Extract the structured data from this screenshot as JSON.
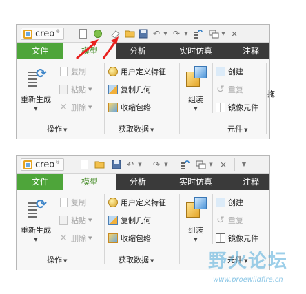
{
  "ribbon_top": {
    "logo_text": "creo",
    "logo_mark": "®",
    "qat_icons": [
      "new-icon",
      "open-icon",
      "save-icon",
      "undo-icon",
      "redo-icon",
      "regenerate-icon",
      "windows-icon",
      "close-window-icon"
    ],
    "tabs": [
      {
        "label": "文件"
      },
      {
        "label": "模型"
      },
      {
        "label": "分析"
      },
      {
        "label": "实时仿真"
      },
      {
        "label": "注释"
      }
    ],
    "groups": {
      "operations": {
        "title": "操作",
        "regenerate": "重新生成",
        "copy": "复制",
        "paste": "粘贴",
        "delete": "删除"
      },
      "get_data": {
        "title": "获取数据",
        "udf": "用户定义特征",
        "copy_geometry": "复制几何",
        "shrinkwrap": "收缩包络"
      },
      "body": {
        "title": "元件",
        "assemble": "组装",
        "create": "创建",
        "repeat": "重复",
        "mirror": "镜像元件"
      }
    },
    "overflow_label": "拖",
    "arrow_color": "#e8201e"
  },
  "ribbon_bottom": {
    "logo_text": "creo",
    "logo_mark": "®",
    "tabs": [
      {
        "label": "文件"
      },
      {
        "label": "模型"
      },
      {
        "label": "分析"
      },
      {
        "label": "实时仿真"
      },
      {
        "label": "注释"
      }
    ],
    "groups": {
      "operations": {
        "title": "操作",
        "regenerate": "重新生成",
        "copy": "复制",
        "paste": "粘贴",
        "delete": "删除"
      },
      "get_data": {
        "title": "获取数据",
        "udf": "用户定义特征",
        "copy_geometry": "复制几何",
        "shrinkwrap": "收缩包络"
      },
      "body": {
        "title": "元件",
        "assemble": "组装",
        "create": "创建",
        "repeat": "重复",
        "mirror": "镜像元件"
      }
    }
  },
  "watermark": {
    "title": "野火论坛",
    "url": "www.proewildfire.cn"
  },
  "colors": {
    "file_tab": "#4ea53a",
    "active_tab_text": "#4a8f2c",
    "tab_bar": "#3a3a3a"
  }
}
